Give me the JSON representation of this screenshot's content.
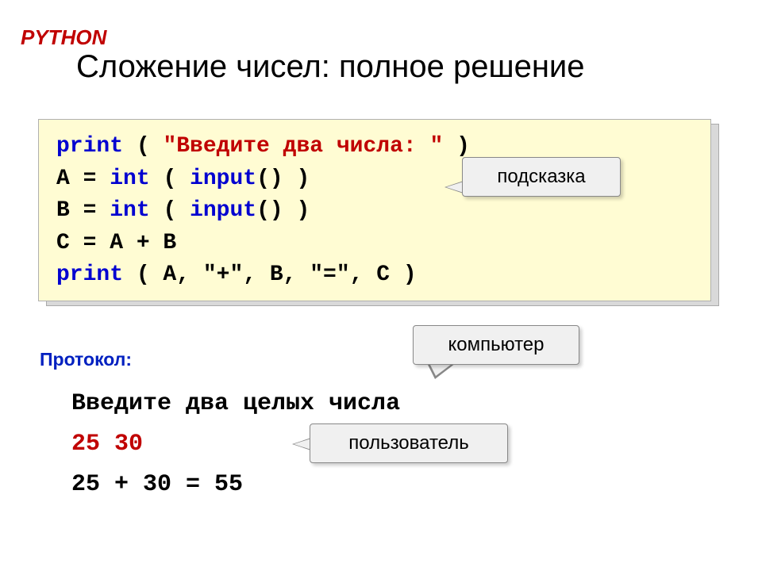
{
  "header": {
    "lang": "PYTHON"
  },
  "title": "Сложение чисел: полное решение",
  "code": {
    "l1_print": "print",
    "l1_open": " ( ",
    "l1_str": "\"Введите два числа: \"",
    "l1_close": " )",
    "l2_a": "A",
    "l2_eq": " = ",
    "l2_int": "int",
    "l2_open": " ( ",
    "l2_input": "input",
    "l2_paren": "()",
    "l2_close": " )",
    "l3_b": "B",
    "l3_eq": " = ",
    "l3_int": "int",
    "l3_open": " ( ",
    "l3_input": "input",
    "l3_paren": "()",
    "l3_close": " )",
    "l4": "C = A + B",
    "l5_print": "print",
    "l5_rest": " ( A, \"+\", B, \"=\", C )"
  },
  "callouts": {
    "hint": "подсказка",
    "computer": "компьютер",
    "user": "пользователь"
  },
  "protocol_label": "Протокол:",
  "output": {
    "l1": "Введите два целых числа",
    "l2": "25 30",
    "l3": "25 + 30 = 55"
  }
}
